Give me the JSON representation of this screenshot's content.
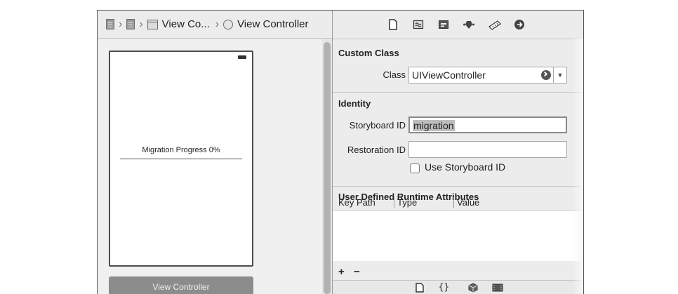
{
  "jumpbar": {
    "items": [
      {
        "label": "",
        "icon": "file-doc-icon"
      },
      {
        "label": "",
        "icon": "file-doc-icon"
      },
      {
        "label": "View Co...",
        "icon": "view-controller-icon"
      },
      {
        "label": "View Controller",
        "icon": "circle-icon"
      }
    ]
  },
  "canvas": {
    "progress_label": "Migration Progress 0%",
    "progress_value": 0,
    "scene_label": "View Controller"
  },
  "inspector": {
    "tabs": [
      "file-icon",
      "quick-help-icon",
      "identity-icon",
      "attributes-icon",
      "size-icon",
      "connections-icon"
    ],
    "custom_class": {
      "title": "Custom Class",
      "class_label": "Class",
      "class_value": "UIViewController"
    },
    "identity": {
      "title": "Identity",
      "storyboard_id_label": "Storyboard ID",
      "storyboard_id_value": "migration",
      "restoration_id_label": "Restoration ID",
      "restoration_id_value": "",
      "use_storyboard_id_label": "Use Storyboard ID",
      "use_storyboard_id_checked": false
    },
    "runtime_attributes": {
      "title": "User Defined Runtime Attributes",
      "columns": [
        "Key Path",
        "Type",
        "Value"
      ],
      "add_label": "+",
      "remove_label": "−"
    },
    "library_tabs": [
      "file-template-icon",
      "code-snippet-icon",
      "object-library-icon",
      "media-library-icon"
    ]
  }
}
